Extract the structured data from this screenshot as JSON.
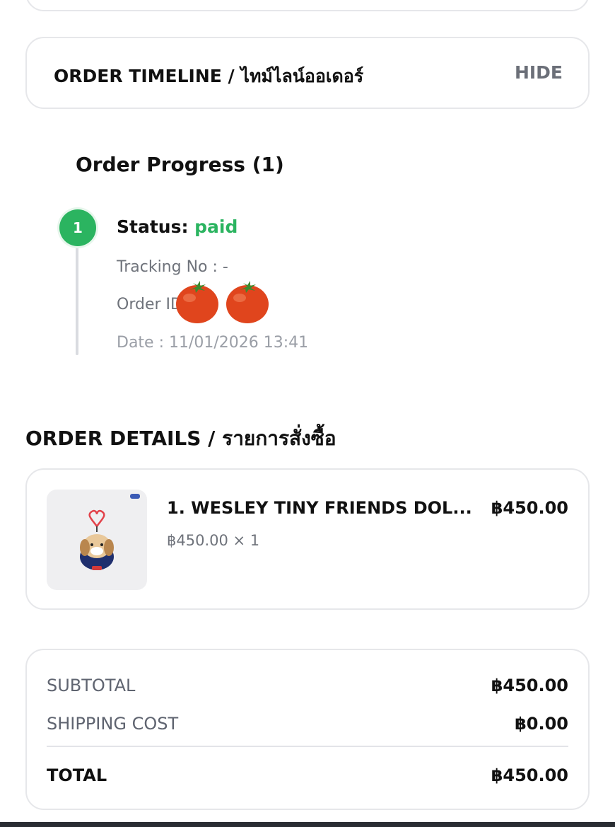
{
  "timeline": {
    "title": "ORDER TIMELINE / ไทม์ไลน์ออเดอร์",
    "hide_label": "HIDE"
  },
  "progress": {
    "title": "Order Progress (1)",
    "step_number": "1",
    "status_label": "Status: ",
    "status_value": "paid",
    "tracking": "Tracking No : -",
    "order_id": "Order ID : 7",
    "date": "Date : 11/01/2026 13:41"
  },
  "details": {
    "title": "ORDER DETAILS / รายการสั่งซื้อ",
    "items": [
      {
        "name": "1. WESLEY TINY FRIENDS DOL...",
        "price": "฿450.00",
        "qty": "฿450.00 × 1"
      }
    ]
  },
  "summary": {
    "subtotal_label": "SUBTOTAL",
    "subtotal_value": "฿450.00",
    "shipping_label": "SHIPPING COST",
    "shipping_value": "฿0.00",
    "total_label": "TOTAL",
    "total_value": "฿450.00"
  },
  "colors": {
    "accent_green": "#2bb460",
    "muted_text": "#6f737b",
    "border": "#e6e7ea"
  }
}
